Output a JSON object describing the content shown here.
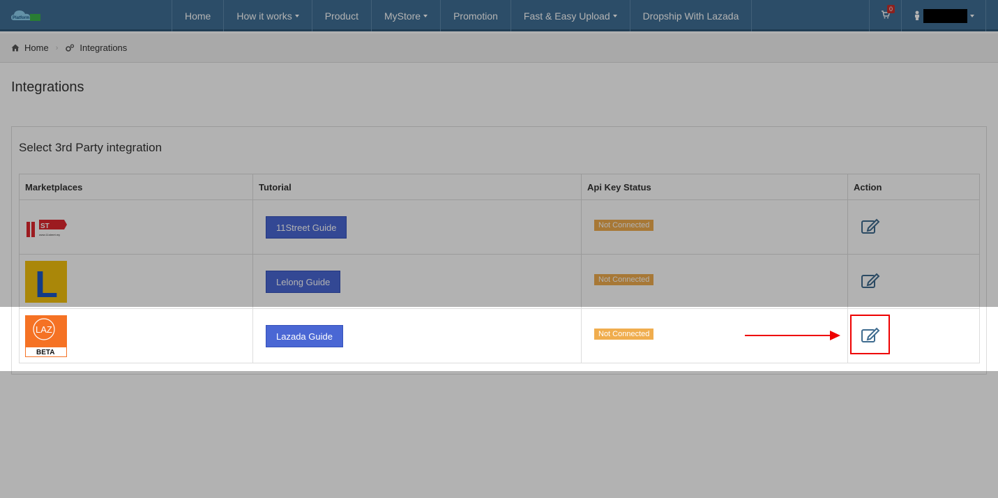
{
  "colors": {
    "navbar": "#3f6f95",
    "guide_button": "#4a67d4",
    "status_warning": "#f0ad4e",
    "highlight": "#ee0000"
  },
  "navbar": {
    "items": [
      {
        "label": "Home",
        "dropdown": false
      },
      {
        "label": "How it works",
        "dropdown": true
      },
      {
        "label": "Product",
        "dropdown": false
      },
      {
        "label": "MyStore",
        "dropdown": true
      },
      {
        "label": "Promotion",
        "dropdown": false
      },
      {
        "label": "Fast & Easy Upload",
        "dropdown": true
      },
      {
        "label": "Dropship With Lazada",
        "dropdown": false
      }
    ],
    "cart_count": "0",
    "user_name": "redacted"
  },
  "breadcrumb": {
    "home": "Home",
    "current": "Integrations"
  },
  "page": {
    "title": "Integrations"
  },
  "panel": {
    "title": "Select 3rd Party integration",
    "headers": {
      "marketplaces": "Marketplaces",
      "tutorial": "Tutorial",
      "api_status": "Api Key Status",
      "action": "Action"
    },
    "rows": [
      {
        "marketplace": "11Street",
        "logo_text": "ST",
        "logo_url_text": "www.11street.my",
        "guide": "11Street Guide",
        "status": "Not Connected"
      },
      {
        "marketplace": "Lelong",
        "logo_text": "L",
        "guide": "Lelong Guide",
        "status": "Not Connected"
      },
      {
        "marketplace": "Lazada",
        "logo_text": "LAZ",
        "logo_sub": "BETA",
        "guide": "Lazada Guide",
        "status": "Not Connected"
      }
    ]
  }
}
